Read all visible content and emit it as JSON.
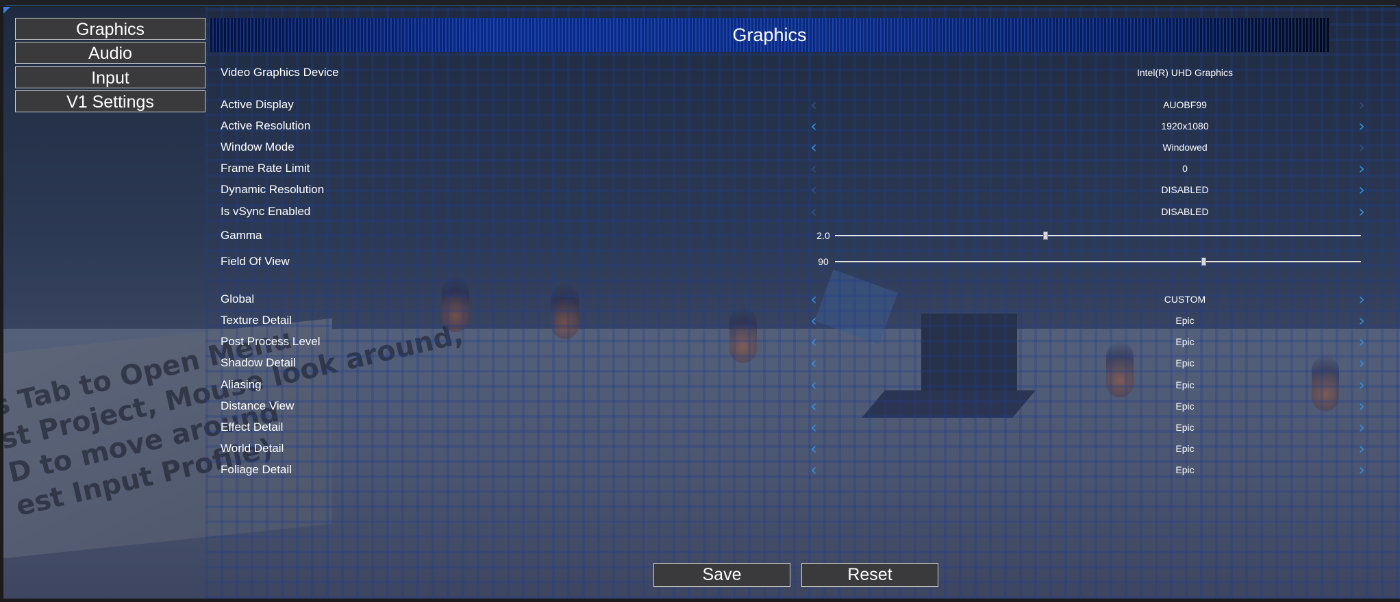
{
  "nav": {
    "items": [
      {
        "label": "Graphics"
      },
      {
        "label": "Audio"
      },
      {
        "label": "Input"
      },
      {
        "label": "V1 Settings"
      }
    ]
  },
  "title": "Graphics",
  "device": {
    "label": "Video Graphics Device",
    "value": "Intel(R) UHD Graphics"
  },
  "display_settings": [
    {
      "label": "Active Display",
      "value": "AUOBF99",
      "left_enabled": false,
      "right_enabled": false
    },
    {
      "label": "Active Resolution",
      "value": "1920x1080",
      "left_enabled": true,
      "right_enabled": true
    },
    {
      "label": "Window Mode",
      "value": "Windowed",
      "left_enabled": true,
      "right_enabled": false
    },
    {
      "label": "Frame Rate Limit",
      "value": "0",
      "left_enabled": false,
      "right_enabled": true
    },
    {
      "label": "Dynamic Resolution",
      "value": "DISABLED",
      "left_enabled": false,
      "right_enabled": true
    },
    {
      "label": "Is vSync Enabled",
      "value": "DISABLED",
      "left_enabled": false,
      "right_enabled": true
    }
  ],
  "sliders": [
    {
      "label": "Gamma",
      "value": "2.0",
      "fraction": 0.4
    },
    {
      "label": "Field Of View",
      "value": "90",
      "fraction": 0.7
    }
  ],
  "quality_settings": [
    {
      "label": "Global",
      "value": "CUSTOM"
    },
    {
      "label": "Texture Detail",
      "value": "Epic"
    },
    {
      "label": "Post Process Level",
      "value": "Epic"
    },
    {
      "label": "Shadow Detail",
      "value": "Epic"
    },
    {
      "label": "Aliasing",
      "value": "Epic"
    },
    {
      "label": "Distance View",
      "value": "Epic"
    },
    {
      "label": "Effect Detail",
      "value": "Epic"
    },
    {
      "label": "World Detail",
      "value": "Epic"
    },
    {
      "label": "Foliage Detail",
      "value": "Epic"
    }
  ],
  "arrows": {
    "left_glyph": "‹",
    "right_glyph": "›"
  },
  "buttons": {
    "save_label": "Save",
    "reset_label": "Reset"
  },
  "scene_text": "s Tab to Open Menu\nst Project, Mouse look around,\nD to move around\nest Input Profile)",
  "colors": {
    "accent": "#2f8fe6",
    "title_bar": "#0a2a88",
    "panel": "#3a3a3c"
  }
}
